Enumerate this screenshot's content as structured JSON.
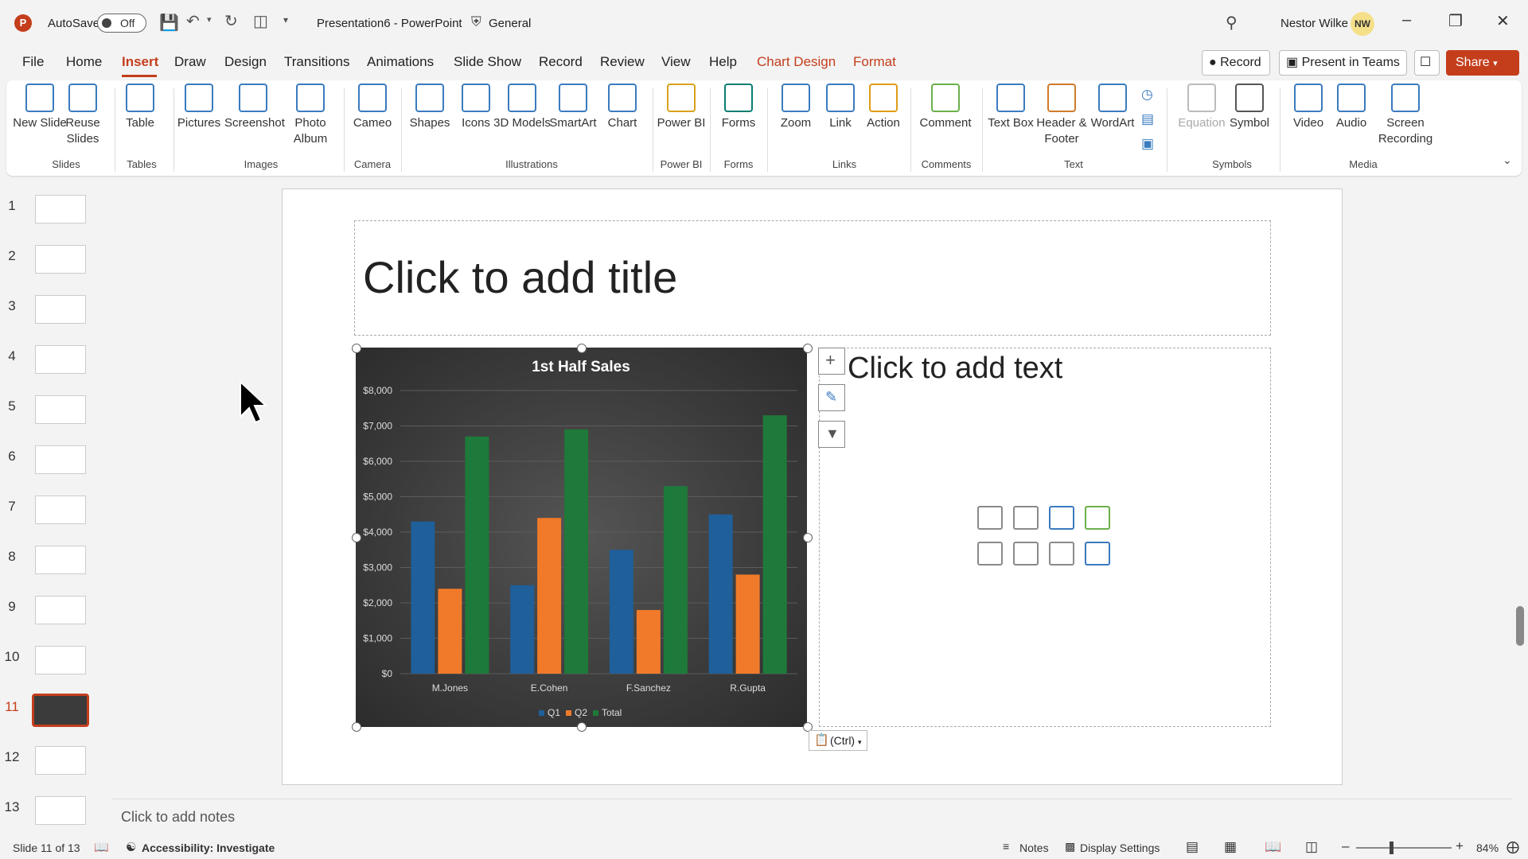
{
  "title_bar": {
    "autosave_label": "AutoSave",
    "autosave_state": "Off",
    "doc_title": "Presentation6 - PowerPoint",
    "sensitivity": "General",
    "user_name": "Nestor Wilke",
    "user_initials": "NW"
  },
  "menu_tabs": [
    "File",
    "Home",
    "Insert",
    "Draw",
    "Design",
    "Transitions",
    "Animations",
    "Slide Show",
    "Record",
    "Review",
    "View",
    "Help",
    "Chart Design",
    "Format"
  ],
  "active_tab": "Insert",
  "menu_right": {
    "record": "Record",
    "present_teams": "Present in Teams",
    "share": "Share"
  },
  "ribbon": {
    "items": {
      "new_slide": "New Slide",
      "reuse_slides": "Reuse Slides",
      "table": "Table",
      "pictures": "Pictures",
      "screenshot": "Screenshot",
      "photo_album": "Photo Album",
      "cameo": "Cameo",
      "shapes": "Shapes",
      "icons": "Icons",
      "3d_models": "3D Models",
      "smartart": "SmartArt",
      "chart": "Chart",
      "power_bi": "Power BI",
      "forms": "Forms",
      "zoom": "Zoom",
      "link": "Link",
      "action": "Action",
      "comment": "Comment",
      "text_box": "Text Box",
      "header_footer": "Header & Footer",
      "wordart": "WordArt",
      "equation": "Equation",
      "symbol": "Symbol",
      "video": "Video",
      "audio": "Audio",
      "screen_recording": "Screen Recording"
    },
    "groups": {
      "slides": "Slides",
      "tables": "Tables",
      "images": "Images",
      "camera": "Camera",
      "illustrations": "Illustrations",
      "power_bi": "Power BI",
      "forms": "Forms",
      "links": "Links",
      "comments": "Comments",
      "text": "Text",
      "symbols": "Symbols",
      "media": "Media"
    }
  },
  "slide_numbers": [
    "1",
    "2",
    "3",
    "4",
    "5",
    "6",
    "7",
    "8",
    "9",
    "10",
    "11",
    "12",
    "13"
  ],
  "current_slide": "11",
  "slide": {
    "title_placeholder": "Click to add title",
    "content_placeholder": "Click to add text",
    "paste_options": "(Ctrl)"
  },
  "chart_data": {
    "type": "bar",
    "title": "1st Half Sales",
    "categories": [
      "M.Jones",
      "E.Cohen",
      "F.Sanchez",
      "R.Gupta"
    ],
    "series": [
      {
        "name": "Q1",
        "values": [
          4300,
          2500,
          3500,
          4500
        ],
        "color": "#1f5f9a"
      },
      {
        "name": "Q2",
        "values": [
          2400,
          4400,
          1800,
          2800
        ],
        "color": "#f07a2a"
      },
      {
        "name": "Total",
        "values": [
          6700,
          6900,
          5300,
          7300
        ],
        "color": "#1e7a3a"
      }
    ],
    "ylim": [
      0,
      8000
    ],
    "y_ticks": [
      "$0",
      "$1,000",
      "$2,000",
      "$3,000",
      "$4,000",
      "$5,000",
      "$6,000",
      "$7,000",
      "$8,000"
    ],
    "legend": "bottom",
    "grid": true
  },
  "notes": "Click to add notes",
  "status_bar": {
    "slide_info": "Slide 11 of 13",
    "accessibility": "Accessibility: Investigate",
    "notes": "Notes",
    "display_settings": "Display Settings",
    "zoom": "84%"
  },
  "colors": {
    "accent": "#c43e1c",
    "chart_bg": "#3b3b3b"
  }
}
